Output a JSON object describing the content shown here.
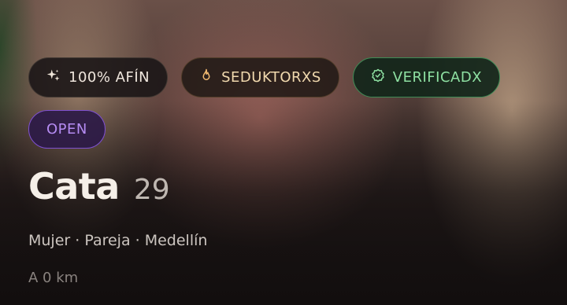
{
  "profile": {
    "badges": [
      {
        "label": "100% AFÍN",
        "icon": "sparkles-icon"
      },
      {
        "label": "SEDUKTORXS",
        "icon": "flame-icon"
      },
      {
        "label": "VERIFICADX",
        "icon": "verified-check-icon"
      }
    ],
    "status_badge": "OPEN",
    "name": "Cata",
    "age": "29",
    "details": "Mujer · Pareja · Medellín",
    "distance": "A 0 km"
  },
  "colors": {
    "verified": "#8ee0a2",
    "open": "#b58cf2",
    "seduktorxs": "#f1d9ae"
  }
}
